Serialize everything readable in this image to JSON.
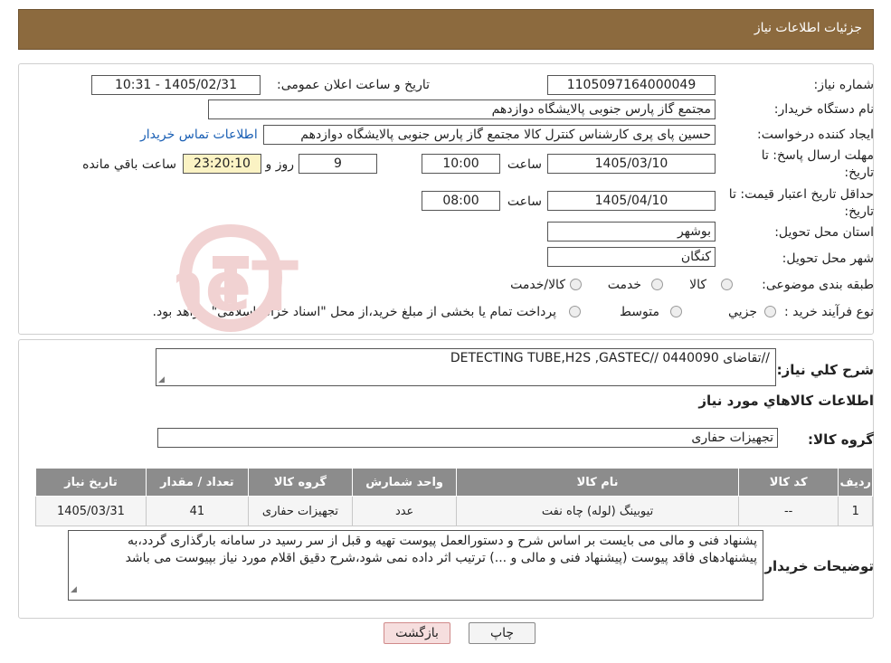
{
  "header": {
    "title": "جزئیات اطلاعات نیاز"
  },
  "need_number": {
    "label": "شماره نیاز:",
    "value": "1105097164000049"
  },
  "announce_datetime": {
    "label": "تاریخ و ساعت اعلان عمومی:",
    "value": "1405/02/31 - 10:31"
  },
  "buyer_org": {
    "label": "نام دستگاه خریدار:",
    "value": "مجتمع گاز پارس جنوبی  پالایشگاه دوازدهم"
  },
  "requester": {
    "label": "ایجاد کننده درخواست:",
    "value": "حسین پای پری کارشناس کنترل کالا مجتمع گاز پارس جنوبی  پالایشگاه دوازدهم",
    "contact_link": "اطلاعات تماس خریدار"
  },
  "reply_deadline": {
    "label_line1": "مهلت ارسال پاسخ: تا",
    "label_line2": "تاریخ:",
    "date": "1405/03/10",
    "time_label": "ساعت",
    "time": "10:00",
    "days": "9",
    "days_label": "روز و",
    "remaining": "23:20:10",
    "remaining_label": "ساعت باقي مانده"
  },
  "price_validity": {
    "label_line1": "حداقل تاریخ اعتبار قیمت: تا",
    "label_line2": "تاریخ:",
    "date": "1405/04/10",
    "time_label": "ساعت",
    "time": "08:00"
  },
  "province": {
    "label": "استان محل تحویل:",
    "value": "بوشهر"
  },
  "city": {
    "label": "شهر محل تحویل:",
    "value": "کنگان"
  },
  "category": {
    "label": "طبقه بندی موضوعی:",
    "options": [
      "کالا",
      "خدمت",
      "کالا/خدمت"
    ]
  },
  "process_type": {
    "label": "نوع فرآیند خرید :",
    "options": [
      "جزيي",
      "متوسط"
    ],
    "note": "پرداخت تمام یا بخشی از مبلغ خرید،از محل \"اسناد خزانه اسلامی\" خواهد بود."
  },
  "description": {
    "label": "شرح کلي نياز:",
    "value": "DETECTING TUBE,H2S ,GASTEC// تقاضای 0440090//"
  },
  "goods_section": {
    "title": "اطلاعات کالاهاي مورد نياز"
  },
  "goods_group": {
    "label": "گروه کالا:",
    "value": "تجهیزات حفاری"
  },
  "table": {
    "headers": [
      "ردیف",
      "کد کالا",
      "نام کالا",
      "واحد شمارش",
      "گروه کالا",
      "تعداد / مقدار",
      "تاریخ نیاز"
    ],
    "rows": [
      [
        "1",
        "--",
        "تیوبینگ (لوله) چاه نفت",
        "عدد",
        "تجهیزات حفاری",
        "41",
        "1405/03/31"
      ]
    ]
  },
  "buyer_notes": {
    "label": "توضیحات خریدار:",
    "value": "پشنهاد فنی و مالی می بایست بر اساس شرح و دستورالعمل پیوست تهیه و قبل از سر رسید در سامانه بارگذاری گردد،به پیشنهادهای فاقد پیوست (پیشنهاد فنی و مالی و ...) ترتیب اثر داده نمی شود،شرح دقیق اقلام مورد نیاز بپیوست می باشد"
  },
  "buttons": {
    "print": "چاپ",
    "back": "بازگشت"
  },
  "colors": {
    "header_bg": "#8c6a3e",
    "table_header_bg": "#8c8c8c",
    "link": "#1a5fb4",
    "back_button_bg": "#f6dede"
  }
}
